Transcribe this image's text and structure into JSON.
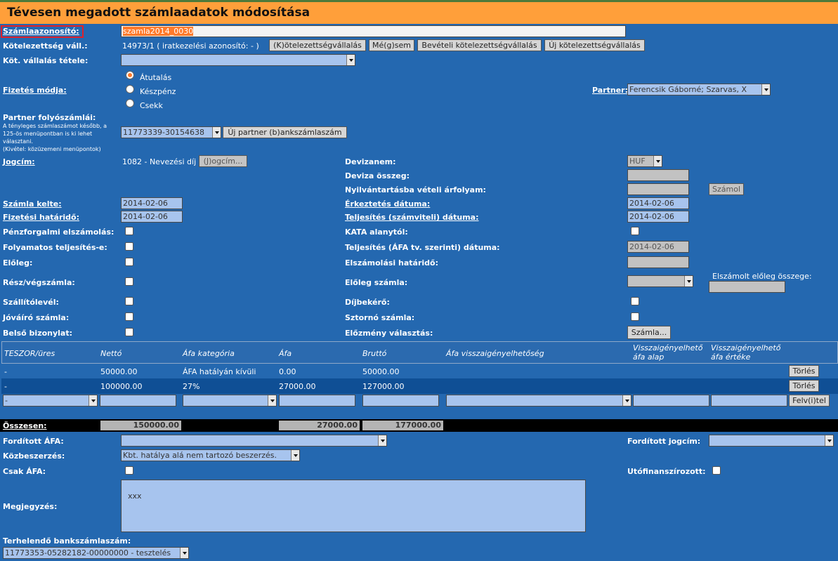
{
  "title": "Tévesen megadott számlaadatok módosítása",
  "labels": {
    "szamlaazonosito": "Számlaazonosító:",
    "kotelezettseg_vall": "Kötelezettség váll.:",
    "kot_vallalas_tetele": "Köt. vállalás tétele:",
    "fizetes_modja": "Fizetés módja:",
    "partner": "Partner:",
    "partner_folyoszamlai": "Partner folyószámlái:",
    "jogcim": "Jogcím:",
    "devizanem": "Devizanem:",
    "deviza_osszeg": "Deviza összeg:",
    "nyilvantartasba": "Nyilvántartásba vételi árfolyam:",
    "szamla_kelte": "Számla kelte:",
    "erkeztetes_datuma": "Érkeztetés dátuma:",
    "fizetesi_hatarido": "Fizetési határidő:",
    "teljesites_szamviteli": "Teljesítés (számviteli) dátuma:",
    "penzforgalmi": "Pénzforgalmi elszámolás:",
    "kata": "KATA alanytól:",
    "folyamatos": "Folyamatos teljesítés-e:",
    "teljesites_afa": "Teljesítés (ÁFA tv. szerinti) dátuma:",
    "eloleg": "Előleg:",
    "elszamolasi_hatarido": "Elszámolási határidő:",
    "resz_vegszamla": "Rész/végszámla:",
    "eloleg_szamla": "Előleg számla:",
    "elszamolt_eloleg": "Elszámolt előleg összege:",
    "szallitolevel": "Szállítólevél:",
    "dijbekero": "Díjbekérő:",
    "jovairo": "Jóváíró számla:",
    "sztorno": "Sztornó számla:",
    "belso_bizonylat": "Belső bizonylat:",
    "elozmeny": "Előzmény választás:",
    "osszesen": "Összesen:",
    "forditott_afa": "Fordított ÁFA:",
    "forditott_jogcim": "Fordított jogcím:",
    "kozbeszerzes": "Közbeszerzés:",
    "csak_afa": "Csak ÁFA:",
    "utofinanszirozott": "Utófinanszírozott:",
    "megjegyzes": "Megjegyzés:",
    "terhelendo": "Terhelendő bankszámlaszám:"
  },
  "partner_note": [
    "A tényleges számlaszámot később, a",
    "125-ös menüpontban is ki lehet",
    "választani.",
    "(Kivétel: közüzemeni menüpontok)"
  ],
  "values": {
    "szamlaazonosito": "szamla2014_0030",
    "kotelezettseg_text": "14973/1 ( iratkezelési azonosító: - )",
    "partner": "Ferencsik Gáborné; Szarvas, X",
    "partner_folyoszamla": "11773339-30154638",
    "jogcim": "1082 - Nevezési díj",
    "devizanem": "HUF",
    "szamla_kelte": "2014-02-06",
    "erkeztetes_datuma": "2014-02-06",
    "fizetesi_hatarido": "2014-02-06",
    "teljesites_szamviteli": "2014-02-06",
    "teljesites_afa": "2014-02-06",
    "kozbeszerzes": "Kbt. hatálya alá nem tartozó beszerzés.",
    "megjegyzes": "xxx",
    "terhelendo": "11773353-05282182-00000000 - tesztelés",
    "new_row_teszor": "-"
  },
  "payment_options": [
    {
      "label": "Átutalás",
      "selected": true
    },
    {
      "label": "Készpénz",
      "selected": false
    },
    {
      "label": "Csekk",
      "selected": false
    }
  ],
  "buttons": {
    "kotelezettsegvallalas": "(K)ötelezettségvállalás",
    "megsem": "Mé(g)sem",
    "beveteli": "Bevételi kötelezettségvállalás",
    "uj_kotelezettseg": "Új kötelezettségvállalás",
    "uj_partner_bank": "Új partner (b)ankszámlaszám",
    "jogcim": "(J)ogcím...",
    "szamol": "Számol",
    "szamla": "Számla...",
    "torles": "Törlés",
    "felvitel": "Felv(i)tel"
  },
  "table": {
    "headers": [
      "TESZOR/üres",
      "Nettó",
      "Áfa kategória",
      "Áfa",
      "Bruttó",
      "Áfa visszaigényelhetőség",
      "Visszaigényelhető áfa alap",
      "Visszaigényelhető áfa értéke"
    ],
    "rows": [
      {
        "teszor": "-",
        "netto": "50000.00",
        "afa_kat": "ÁFA hatályán kívüli",
        "afa": "0.00",
        "brutto": "50000.00",
        "action": "Törlés"
      },
      {
        "teszor": "-",
        "netto": "100000.00",
        "afa_kat": "27%",
        "afa": "27000.00",
        "brutto": "127000.00",
        "action": "Törlés"
      }
    ],
    "totals": {
      "netto": "150000.00",
      "afa": "27000.00",
      "brutto": "177000.00"
    }
  },
  "colors": {
    "background": "#2468b0",
    "title_bar": "#ff9f3a",
    "input": "#a7c4ee",
    "selected_row": "#0f4f95",
    "highlight_border": "#e0202a"
  }
}
